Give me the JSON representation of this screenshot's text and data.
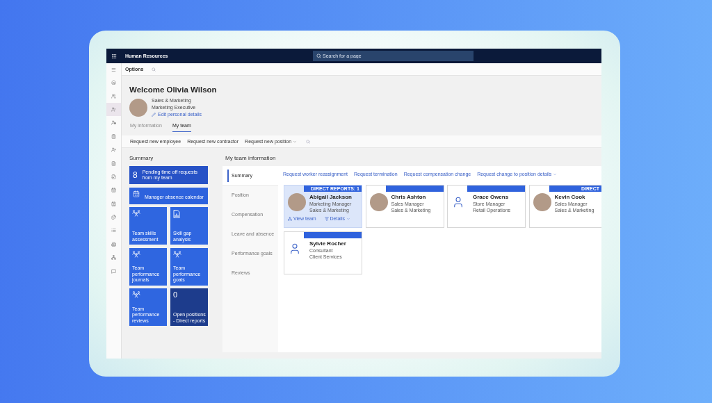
{
  "app_bar": {
    "title": "Human Resources",
    "search": {
      "placeholder": "Search for a page"
    }
  },
  "nav_rail": {
    "items": [
      {
        "selected": false
      },
      {
        "selected": false
      },
      {
        "selected": true
      },
      {
        "selected": false
      },
      {
        "selected": false
      },
      {
        "selected": false
      },
      {
        "selected": false
      },
      {
        "selected": false
      },
      {
        "selected": false
      },
      {
        "selected": false
      },
      {
        "selected": false
      },
      {
        "selected": false
      },
      {
        "selected": false
      },
      {
        "selected": false
      },
      {
        "selected": false
      }
    ]
  },
  "options_bar": {
    "label": "Options"
  },
  "profile": {
    "greeting": "Welcome Olivia Wilson",
    "department": "Sales & Marketing",
    "job_title": "Marketing Executive",
    "edit_link": "Edit personal details"
  },
  "tabs": [
    {
      "label": "My information",
      "selected": false
    },
    {
      "label": "My team",
      "selected": true
    }
  ],
  "action_bar": {
    "actions": [
      {
        "label": "Request new employee",
        "dropdown": false
      },
      {
        "label": "Request new contractor",
        "dropdown": false
      },
      {
        "label": "Request new position",
        "dropdown": true
      }
    ]
  },
  "summary": {
    "title": "Summary",
    "tiles": [
      {
        "kind": "count",
        "wide": true,
        "count": "8",
        "label": "Pending time off requests from my team",
        "color": "#2752c6"
      },
      {
        "kind": "calendar",
        "wide": true,
        "label": "Manager absence calendar",
        "color": "#2d62dd"
      },
      {
        "kind": "team",
        "wide": false,
        "label": "Team skills assessment",
        "color": "#2f66e0"
      },
      {
        "kind": "report",
        "wide": false,
        "label": "Skill gap analysis",
        "color": "#2f66e0"
      },
      {
        "kind": "team",
        "wide": false,
        "label": "Team performance journals",
        "color": "#2f66e0"
      },
      {
        "kind": "team",
        "wide": false,
        "label": "Team performance goals",
        "color": "#2f66e0"
      },
      {
        "kind": "team",
        "wide": false,
        "label": "Team performance reviews",
        "color": "#2f66e0"
      },
      {
        "kind": "count",
        "wide": false,
        "count": "0",
        "label": "Open positions - Direct reports",
        "color": "#1d3c8c"
      }
    ]
  },
  "team_info": {
    "title": "My team information",
    "sections": [
      {
        "label": "Summary",
        "selected": true
      },
      {
        "label": "Position",
        "selected": false
      },
      {
        "label": "Compensation",
        "selected": false
      },
      {
        "label": "Leave and absence",
        "selected": false
      },
      {
        "label": "Performance goals",
        "selected": false
      },
      {
        "label": "Reviews",
        "selected": false
      }
    ],
    "actions": [
      {
        "label": "Request worker reassignment",
        "dropdown": false
      },
      {
        "label": "Request termination",
        "dropdown": false
      },
      {
        "label": "Request compensation change",
        "dropdown": false
      },
      {
        "label": "Request change to position details",
        "dropdown": true
      }
    ],
    "workers": [
      {
        "name": "Abigail Jackson",
        "job_title": "Marketing Manager",
        "department": "Sales & Marketing",
        "kind": "photo",
        "selected": true,
        "badge": "DIRECT REPORTS: 1",
        "links": [
          {
            "label": "View team",
            "kind": "team",
            "dropdown": false
          },
          {
            "label": "Details",
            "kind": "details",
            "dropdown": true
          }
        ]
      },
      {
        "name": "Chris Ashton",
        "job_title": "Sales Manager",
        "department": "Sales & Marketing",
        "kind": "photo",
        "selected": false
      },
      {
        "name": "Grace Owens",
        "job_title": "Store Manager",
        "department": "Retail Operations",
        "kind": "placeholder",
        "selected": false
      },
      {
        "name": "Kevin Cook",
        "job_title": "Sales Manager",
        "department": "Sales & Marketing",
        "kind": "photo",
        "selected": false,
        "badge": "DIRECT"
      },
      {
        "name": "Sylvie Rocher",
        "job_title": "Consultant",
        "department": "Client Services",
        "kind": "placeholder",
        "selected": false
      }
    ]
  }
}
